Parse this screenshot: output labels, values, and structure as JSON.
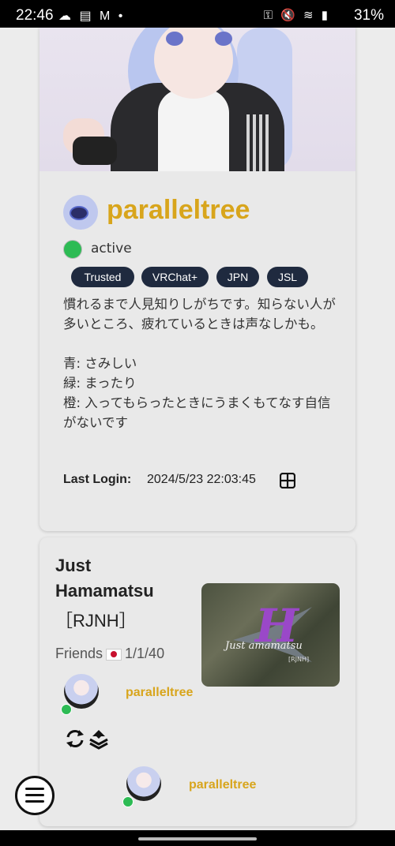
{
  "status_bar": {
    "time": "22:46",
    "left_icons": "☁ ▤ M •",
    "right_icons": "⚿ 🔇 ≋ ▮",
    "battery": "31%"
  },
  "profile": {
    "username": "paralleltree",
    "status": "active",
    "status_color": "#2dbb54",
    "tags": [
      "Trusted",
      "VRChat+",
      "JPN",
      "JSL"
    ],
    "bio": "慣れるまで人見知りしがちです。知らない人が多いところ、疲れているときは声なしかも。\n\n青: さみしい\n緑: まったり\n橙: 入ってもらったときにうまくもてなす自信がないです",
    "last_login_label": "Last Login:",
    "last_login_value": "2024/5/23 22:03:45",
    "platform_icon": "windows-icon"
  },
  "world": {
    "name": "Just Hamamatsu",
    "code": "［RJNH］",
    "friends_label": "Friends",
    "region_flag": "JP",
    "counts": "1/1/40",
    "thumbnail": {
      "logo_letter": "H",
      "logo_text": "Just  amamatsu",
      "logo_code": "[RJNH]"
    },
    "members": [
      {
        "name": "paralleltree"
      },
      {
        "name": "paralleltree"
      }
    ]
  },
  "colors": {
    "accent": "#d8a51c",
    "tag_bg": "#1f2a3f",
    "online": "#2dbb54"
  }
}
